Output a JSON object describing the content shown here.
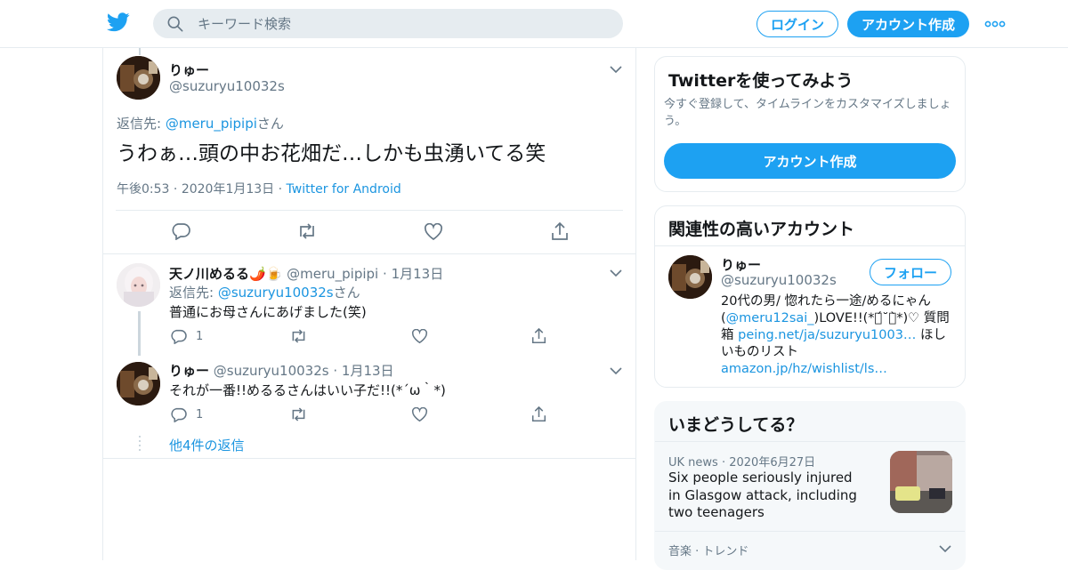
{
  "header": {
    "search_placeholder": "キーワード検索",
    "login_label": "ログイン",
    "signup_label": "アカウント作成"
  },
  "focus_tweet": {
    "name": "りゅー",
    "handle": "@suzuryu10032s",
    "reply_prefix": "返信先: ",
    "reply_target": "@meru_pipipi",
    "reply_suffix": "さん",
    "text": "うわぁ…頭の中お花畑だ…しかも虫湧いてる笑",
    "time": "午後0:53",
    "date": "2020年1月13日",
    "source": "Twitter for Android"
  },
  "replies": [
    {
      "name": "天ノ川めるる🌶️🍺",
      "handle": "@meru_pipipi",
      "date": "1月13日",
      "reply_prefix": "返信先: ",
      "reply_target": "@suzuryu10032s",
      "reply_suffix": "さん",
      "text": "普通にお母さんにあげました(笑)",
      "reply_count": "1"
    },
    {
      "name": "りゅー",
      "handle": "@suzuryu10032s",
      "date": "1月13日",
      "text": "それが一番!!めるるさんはいい子だ!!(*´ω｀*)",
      "reply_count": "1"
    }
  ],
  "more_replies": "他4件の返信",
  "sidebar": {
    "signup_card": {
      "title": "Twitterを使ってみよう",
      "desc": "今すぐ登録して、タイムラインをカスタマイズしましょう。",
      "button": "アカウント作成"
    },
    "related_card": {
      "title": "関連性の高いアカウント",
      "name": "りゅー",
      "handle": "@suzuryu10032s",
      "follow": "フォロー",
      "bio_1": "20代の男/ 惚れたら一途/めるにゃん(",
      "bio_link1": "@meru12sai_",
      "bio_2": ")LOVE!!(*ฅ́˘ฅ̀*)♡ 質問箱 ",
      "bio_link2": "peing.net/ja/suzuryu1003…",
      "bio_3": " ほしいものリスト ",
      "bio_link3": "amazon.jp/hz/wishlist/ls…"
    },
    "trends_card": {
      "title": "いまどうしてる？",
      "news_source": "UK news",
      "news_date": "2020年6月27日",
      "news_headline": "Six people seriously injured in Glasgow attack, including two teenagers",
      "trend_label": "音楽 · トレンド"
    }
  },
  "colors": {
    "brand": "#1da1f2",
    "link": "#1b95e0",
    "text": "#14171a",
    "muted": "#657786",
    "border": "#e6ecf0"
  }
}
